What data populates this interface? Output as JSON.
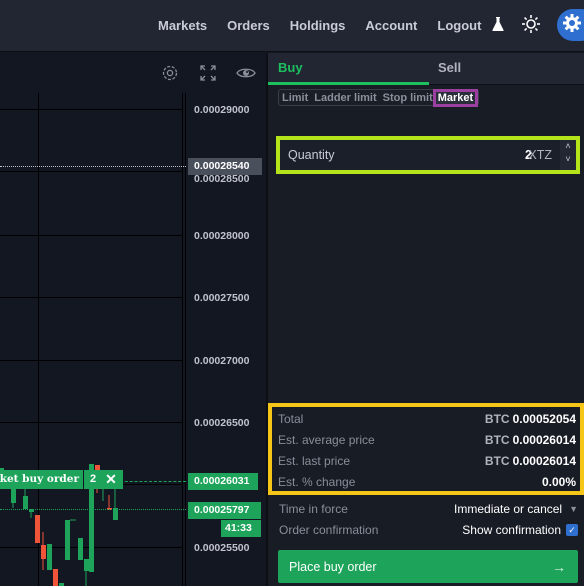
{
  "nav": {
    "items": [
      "Markets",
      "Orders",
      "Holdings",
      "Account",
      "Logout"
    ],
    "icons": [
      "flask-icon",
      "sun-icon",
      "gear-icon"
    ]
  },
  "chart": {
    "toolbar_icons": [
      "settings-icon",
      "fullscreen-icon",
      "eye-icon"
    ],
    "price_axis": [
      "0.00029000",
      "0.00028500",
      "0.00028000",
      "0.00027500",
      "0.00027000",
      "0.00026500",
      "0.00025500"
    ],
    "current_price_tag": "0.00028540",
    "order_line_price": "0.00026031",
    "last_price": "0.00025797",
    "countdown": "41:33",
    "order_label": "Market buy order",
    "order_qty": "2",
    "colors": {
      "up": "#1da35a",
      "down": "#f0553a",
      "tag_grey": "#4a4f5c"
    }
  },
  "panel": {
    "tabs": {
      "buy": "Buy",
      "sell": "Sell"
    },
    "order_types": [
      "Limit",
      "Ladder limit",
      "Stop limit",
      "Market"
    ],
    "active_order_type": "Market",
    "quantity": {
      "label": "Quantity",
      "value": "2",
      "unit": "XTZ"
    },
    "summary": [
      {
        "label": "Total",
        "currency": "BTC",
        "value": "0.00052054"
      },
      {
        "label": "Est. average price",
        "currency": "BTC",
        "value": "0.00026014"
      },
      {
        "label": "Est. last price",
        "currency": "BTC",
        "value": "0.00026014"
      },
      {
        "label": "Est. % change",
        "currency": "",
        "value": "0.00%"
      }
    ],
    "time_in_force": {
      "label": "Time in force",
      "value": "Immediate or cancel"
    },
    "order_confirmation": {
      "label": "Order confirmation",
      "value": "Show confirmation",
      "checked": true
    },
    "place_button": "Place buy order",
    "colors": {
      "buy": "#1dbf5f",
      "highlight_qty": "#b5e41a",
      "highlight_summary": "#f5c518",
      "highlight_type": "#9b3fa0"
    }
  }
}
